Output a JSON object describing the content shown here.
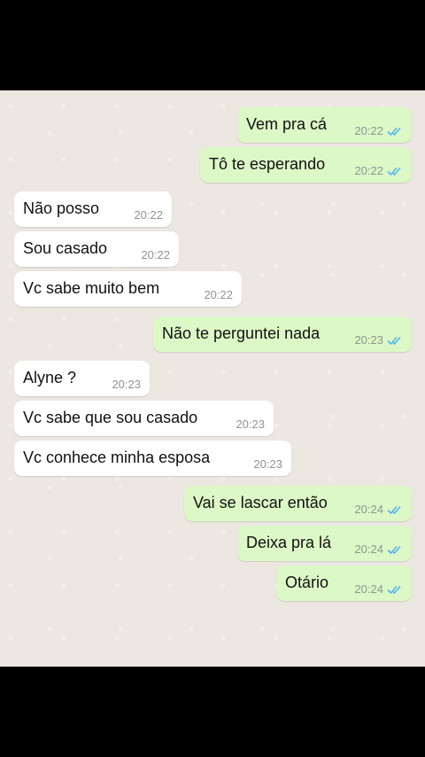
{
  "chat": {
    "messages": [
      {
        "text": "Vem pra cá",
        "time": "20:22",
        "direction": "out",
        "status": "double-check-read-icon"
      },
      {
        "text": "Tô te esperando",
        "time": "20:22",
        "direction": "out",
        "status": "double-check-read-icon"
      },
      {
        "text": "Não posso",
        "time": "20:22",
        "direction": "in"
      },
      {
        "text": "Sou casado",
        "time": "20:22",
        "direction": "in"
      },
      {
        "text": "Vc sabe muito bem",
        "time": "20:22",
        "direction": "in"
      },
      {
        "text": "Não te perguntei nada",
        "time": "20:23",
        "direction": "out",
        "status": "double-check-read-icon"
      },
      {
        "text": "Alyne ?",
        "time": "20:23",
        "direction": "in"
      },
      {
        "text": "Vc sabe que sou casado",
        "time": "20:23",
        "direction": "in"
      },
      {
        "text": "Vc conhece minha esposa",
        "time": "20:23",
        "direction": "in"
      },
      {
        "text": "Vai se lascar então",
        "time": "20:24",
        "direction": "out",
        "status": "double-check-read-icon"
      },
      {
        "text": "Deixa pra lá",
        "time": "20:24",
        "direction": "out",
        "status": "double-check-read-icon"
      },
      {
        "text": "Otário",
        "time": "20:24",
        "direction": "out",
        "status": "double-check-read-icon"
      }
    ]
  },
  "colors": {
    "incoming_bubble": "#FFFFFF",
    "outgoing_bubble": "#DCF8C6",
    "read_ticks": "#4FB6EC",
    "chat_background": "#ECE7E1"
  }
}
